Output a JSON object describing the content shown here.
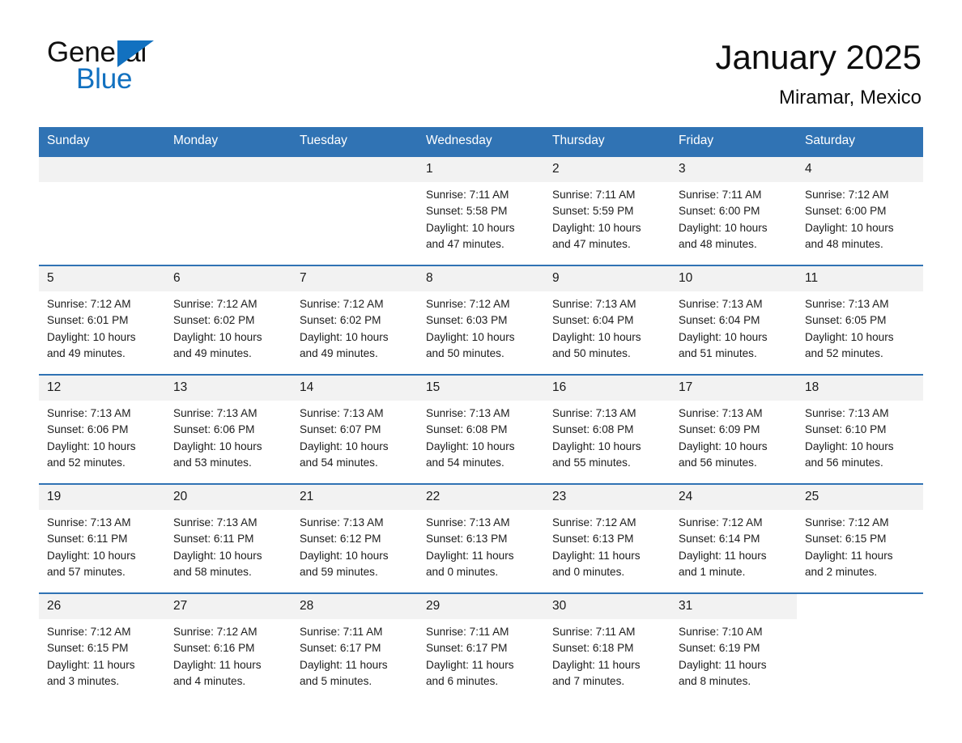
{
  "brand": {
    "name_part1": "General",
    "name_part2": "Blue",
    "flag_icon": "brand-triangle-icon",
    "accent_color": "#1271c0"
  },
  "header": {
    "title": "January 2025",
    "subtitle": "Miramar, Mexico"
  },
  "theme": {
    "header_blue": "#3073b4",
    "daynum_band": "#f2f2f2",
    "text": "#1a1a1a"
  },
  "calendar": {
    "weekday_headers": [
      "Sunday",
      "Monday",
      "Tuesday",
      "Wednesday",
      "Thursday",
      "Friday",
      "Saturday"
    ],
    "weeks": [
      [
        {
          "empty": true
        },
        {
          "empty": true
        },
        {
          "empty": true
        },
        {
          "day": "1",
          "sunrise": "Sunrise: 7:11 AM",
          "sunset": "Sunset: 5:58 PM",
          "daylight_line1": "Daylight: 10 hours",
          "daylight_line2": "and 47 minutes."
        },
        {
          "day": "2",
          "sunrise": "Sunrise: 7:11 AM",
          "sunset": "Sunset: 5:59 PM",
          "daylight_line1": "Daylight: 10 hours",
          "daylight_line2": "and 47 minutes."
        },
        {
          "day": "3",
          "sunrise": "Sunrise: 7:11 AM",
          "sunset": "Sunset: 6:00 PM",
          "daylight_line1": "Daylight: 10 hours",
          "daylight_line2": "and 48 minutes."
        },
        {
          "day": "4",
          "sunrise": "Sunrise: 7:12 AM",
          "sunset": "Sunset: 6:00 PM",
          "daylight_line1": "Daylight: 10 hours",
          "daylight_line2": "and 48 minutes."
        }
      ],
      [
        {
          "day": "5",
          "sunrise": "Sunrise: 7:12 AM",
          "sunset": "Sunset: 6:01 PM",
          "daylight_line1": "Daylight: 10 hours",
          "daylight_line2": "and 49 minutes."
        },
        {
          "day": "6",
          "sunrise": "Sunrise: 7:12 AM",
          "sunset": "Sunset: 6:02 PM",
          "daylight_line1": "Daylight: 10 hours",
          "daylight_line2": "and 49 minutes."
        },
        {
          "day": "7",
          "sunrise": "Sunrise: 7:12 AM",
          "sunset": "Sunset: 6:02 PM",
          "daylight_line1": "Daylight: 10 hours",
          "daylight_line2": "and 49 minutes."
        },
        {
          "day": "8",
          "sunrise": "Sunrise: 7:12 AM",
          "sunset": "Sunset: 6:03 PM",
          "daylight_line1": "Daylight: 10 hours",
          "daylight_line2": "and 50 minutes."
        },
        {
          "day": "9",
          "sunrise": "Sunrise: 7:13 AM",
          "sunset": "Sunset: 6:04 PM",
          "daylight_line1": "Daylight: 10 hours",
          "daylight_line2": "and 50 minutes."
        },
        {
          "day": "10",
          "sunrise": "Sunrise: 7:13 AM",
          "sunset": "Sunset: 6:04 PM",
          "daylight_line1": "Daylight: 10 hours",
          "daylight_line2": "and 51 minutes."
        },
        {
          "day": "11",
          "sunrise": "Sunrise: 7:13 AM",
          "sunset": "Sunset: 6:05 PM",
          "daylight_line1": "Daylight: 10 hours",
          "daylight_line2": "and 52 minutes."
        }
      ],
      [
        {
          "day": "12",
          "sunrise": "Sunrise: 7:13 AM",
          "sunset": "Sunset: 6:06 PM",
          "daylight_line1": "Daylight: 10 hours",
          "daylight_line2": "and 52 minutes."
        },
        {
          "day": "13",
          "sunrise": "Sunrise: 7:13 AM",
          "sunset": "Sunset: 6:06 PM",
          "daylight_line1": "Daylight: 10 hours",
          "daylight_line2": "and 53 minutes."
        },
        {
          "day": "14",
          "sunrise": "Sunrise: 7:13 AM",
          "sunset": "Sunset: 6:07 PM",
          "daylight_line1": "Daylight: 10 hours",
          "daylight_line2": "and 54 minutes."
        },
        {
          "day": "15",
          "sunrise": "Sunrise: 7:13 AM",
          "sunset": "Sunset: 6:08 PM",
          "daylight_line1": "Daylight: 10 hours",
          "daylight_line2": "and 54 minutes."
        },
        {
          "day": "16",
          "sunrise": "Sunrise: 7:13 AM",
          "sunset": "Sunset: 6:08 PM",
          "daylight_line1": "Daylight: 10 hours",
          "daylight_line2": "and 55 minutes."
        },
        {
          "day": "17",
          "sunrise": "Sunrise: 7:13 AM",
          "sunset": "Sunset: 6:09 PM",
          "daylight_line1": "Daylight: 10 hours",
          "daylight_line2": "and 56 minutes."
        },
        {
          "day": "18",
          "sunrise": "Sunrise: 7:13 AM",
          "sunset": "Sunset: 6:10 PM",
          "daylight_line1": "Daylight: 10 hours",
          "daylight_line2": "and 56 minutes."
        }
      ],
      [
        {
          "day": "19",
          "sunrise": "Sunrise: 7:13 AM",
          "sunset": "Sunset: 6:11 PM",
          "daylight_line1": "Daylight: 10 hours",
          "daylight_line2": "and 57 minutes."
        },
        {
          "day": "20",
          "sunrise": "Sunrise: 7:13 AM",
          "sunset": "Sunset: 6:11 PM",
          "daylight_line1": "Daylight: 10 hours",
          "daylight_line2": "and 58 minutes."
        },
        {
          "day": "21",
          "sunrise": "Sunrise: 7:13 AM",
          "sunset": "Sunset: 6:12 PM",
          "daylight_line1": "Daylight: 10 hours",
          "daylight_line2": "and 59 minutes."
        },
        {
          "day": "22",
          "sunrise": "Sunrise: 7:13 AM",
          "sunset": "Sunset: 6:13 PM",
          "daylight_line1": "Daylight: 11 hours",
          "daylight_line2": "and 0 minutes."
        },
        {
          "day": "23",
          "sunrise": "Sunrise: 7:12 AM",
          "sunset": "Sunset: 6:13 PM",
          "daylight_line1": "Daylight: 11 hours",
          "daylight_line2": "and 0 minutes."
        },
        {
          "day": "24",
          "sunrise": "Sunrise: 7:12 AM",
          "sunset": "Sunset: 6:14 PM",
          "daylight_line1": "Daylight: 11 hours",
          "daylight_line2": "and 1 minute."
        },
        {
          "day": "25",
          "sunrise": "Sunrise: 7:12 AM",
          "sunset": "Sunset: 6:15 PM",
          "daylight_line1": "Daylight: 11 hours",
          "daylight_line2": "and 2 minutes."
        }
      ],
      [
        {
          "day": "26",
          "sunrise": "Sunrise: 7:12 AM",
          "sunset": "Sunset: 6:15 PM",
          "daylight_line1": "Daylight: 11 hours",
          "daylight_line2": "and 3 minutes."
        },
        {
          "day": "27",
          "sunrise": "Sunrise: 7:12 AM",
          "sunset": "Sunset: 6:16 PM",
          "daylight_line1": "Daylight: 11 hours",
          "daylight_line2": "and 4 minutes."
        },
        {
          "day": "28",
          "sunrise": "Sunrise: 7:11 AM",
          "sunset": "Sunset: 6:17 PM",
          "daylight_line1": "Daylight: 11 hours",
          "daylight_line2": "and 5 minutes."
        },
        {
          "day": "29",
          "sunrise": "Sunrise: 7:11 AM",
          "sunset": "Sunset: 6:17 PM",
          "daylight_line1": "Daylight: 11 hours",
          "daylight_line2": "and 6 minutes."
        },
        {
          "day": "30",
          "sunrise": "Sunrise: 7:11 AM",
          "sunset": "Sunset: 6:18 PM",
          "daylight_line1": "Daylight: 11 hours",
          "daylight_line2": "and 7 minutes."
        },
        {
          "day": "31",
          "sunrise": "Sunrise: 7:10 AM",
          "sunset": "Sunset: 6:19 PM",
          "daylight_line1": "Daylight: 11 hours",
          "daylight_line2": "and 8 minutes."
        },
        {
          "empty": true,
          "blank": true
        }
      ]
    ]
  }
}
